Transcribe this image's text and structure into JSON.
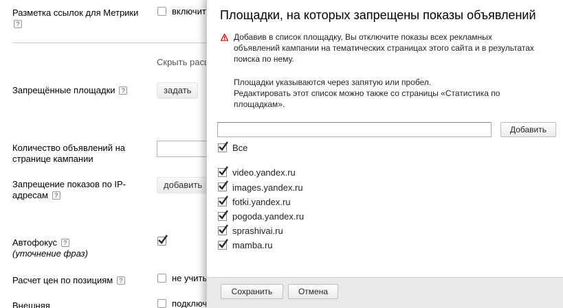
{
  "background": {
    "metrika_label": "Разметка ссылок для Метрики",
    "metrika_value": "включить",
    "hide_link": "Скрыть расш",
    "forbidden_sites_label": "Запрещённые площадки",
    "set_button": "задать",
    "ads_count_label_1": "Количество объявлений на",
    "ads_count_label_2": "странице кампании",
    "ip_block_label_1": "Запрещение показов по IP-",
    "ip_block_label_2": "адресам",
    "add_button": "добавить",
    "autofocus_label": "Автофокус",
    "autofocus_sub": "(уточнение фраз)",
    "price_calc_label": "Расчет цен по позициям",
    "price_calc_value": "не учиты",
    "external_label": "Внешняя",
    "external_value": "подключить",
    "help_glyph": "?"
  },
  "popup": {
    "title": "Площадки, на которых запрещены показы объявлений",
    "warning_lines": [
      "Добавив в список площадку, Вы отключите показы всех рекламных",
      "объявлений кампании на тематических страницах этого сайта и в результатах",
      "поиска по нему."
    ],
    "info_lines": [
      "Площадки указываются через запятую или пробел.",
      "Редактировать этот список можно также со страницы «Статистика по",
      "площадкам»."
    ],
    "input_value": "",
    "add_button": "Добавить",
    "all_label": "Все",
    "sites": [
      "video.yandex.ru",
      "images.yandex.ru",
      "fotki.yandex.ru",
      "pogoda.yandex.ru",
      "sprashivai.ru",
      "mamba.ru"
    ],
    "save_button": "Сохранить",
    "cancel_button": "Отмена"
  },
  "colors": {
    "warning": "#cc0000",
    "footer_bg": "#e9e9e9"
  }
}
